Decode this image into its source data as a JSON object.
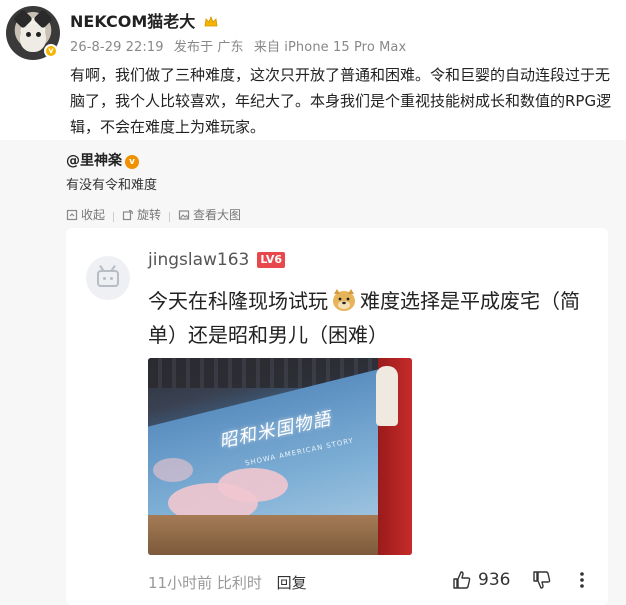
{
  "post": {
    "username": "NEKCOM猫老大",
    "meta": {
      "time": "26-8-29 22:19",
      "from": "发布于 广东",
      "device": "来自 iPhone 15 Pro Max"
    },
    "text": "有啊，我们做了三种难度，这次只开放了普通和困难。令和巨婴的自动连段过于无脑了，我个人比较喜欢，年纪大了。本身我们是个重视技能树成长和数值的RPG逻辑，不会在难度上为难玩家。"
  },
  "repost": {
    "author": "@里神楽",
    "text": "有没有令和难度",
    "actions": {
      "collect": "收起",
      "forward": "旋转",
      "view_image": "查看大图"
    },
    "card": {
      "name": "jingslaw163",
      "level": "LV6",
      "text_before": "今天在科隆现场试玩",
      "text_after": "难度选择是平成废宅（简单）还是昭和男儿（困难）",
      "photo_logo": "昭和米国物語",
      "photo_subtitle": "SHOWA AMERICAN STORY",
      "time": "11小时前",
      "location": "比利时",
      "reply": "回复",
      "likes": "936"
    }
  },
  "colors": {
    "level_badge": "#e8484c",
    "verified_badge": "#f5b400",
    "meta_gray": "#888888"
  }
}
